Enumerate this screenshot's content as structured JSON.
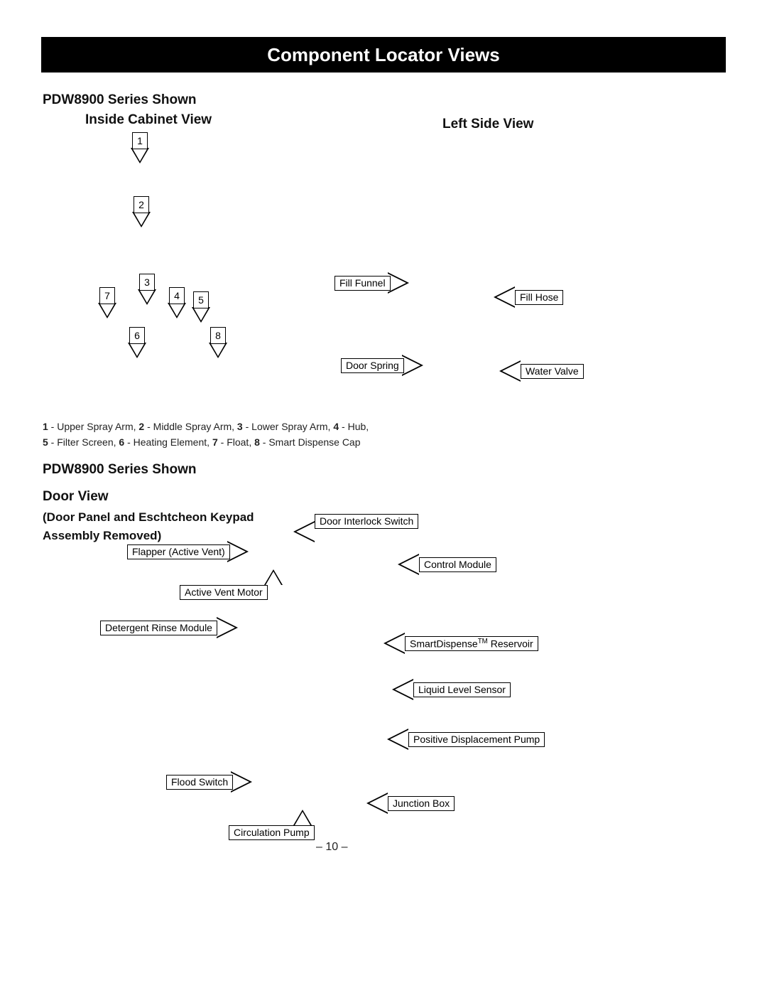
{
  "title": "Component Locator Views",
  "series_label": "PDW8900 Series Shown",
  "views": {
    "inside_cabinet": "Inside Cabinet View",
    "left_side": "Left Side View",
    "door": "Door View"
  },
  "door_subtitle_line1": "(Door Panel and Eschtcheon Keypad",
  "door_subtitle_line2": "Assembly Removed)",
  "numbered_markers": {
    "1": "1",
    "2": "2",
    "3": "3",
    "4": "4",
    "5": "5",
    "6": "6",
    "7": "7",
    "8": "8"
  },
  "legend_items": [
    {
      "n": "1",
      "t": "Upper Spray Arm"
    },
    {
      "n": "2",
      "t": "Middle Spray Arm"
    },
    {
      "n": "3",
      "t": "Lower Spray Arm"
    },
    {
      "n": "4",
      "t": "Hub"
    },
    {
      "n": "5",
      "t": "Filter Screen"
    },
    {
      "n": "6",
      "t": "Heating Element"
    },
    {
      "n": "7",
      "t": "Float"
    },
    {
      "n": "8",
      "t": "Smart Dispense Cap"
    }
  ],
  "callouts": {
    "fill_funnel": "Fill Funnel",
    "fill_hose": "Fill Hose",
    "door_spring": "Door Spring",
    "water_valve": "Water Valve",
    "flapper": "Flapper (Active Vent)",
    "door_interlock": "Door Interlock Switch",
    "active_vent_motor": "Active Vent Motor",
    "control_module": "Control Module",
    "detergent_rinse": "Detergent Rinse Module",
    "smartdispense": "SmartDispense™ Reservoir",
    "liquid_level": "Liquid Level Sensor",
    "positive_pump": "Positive Displacement Pump",
    "flood_switch": "Flood Switch",
    "junction_box": "Junction Box",
    "circulation_pump": "Circulation Pump"
  },
  "page_number": "– 10 –"
}
